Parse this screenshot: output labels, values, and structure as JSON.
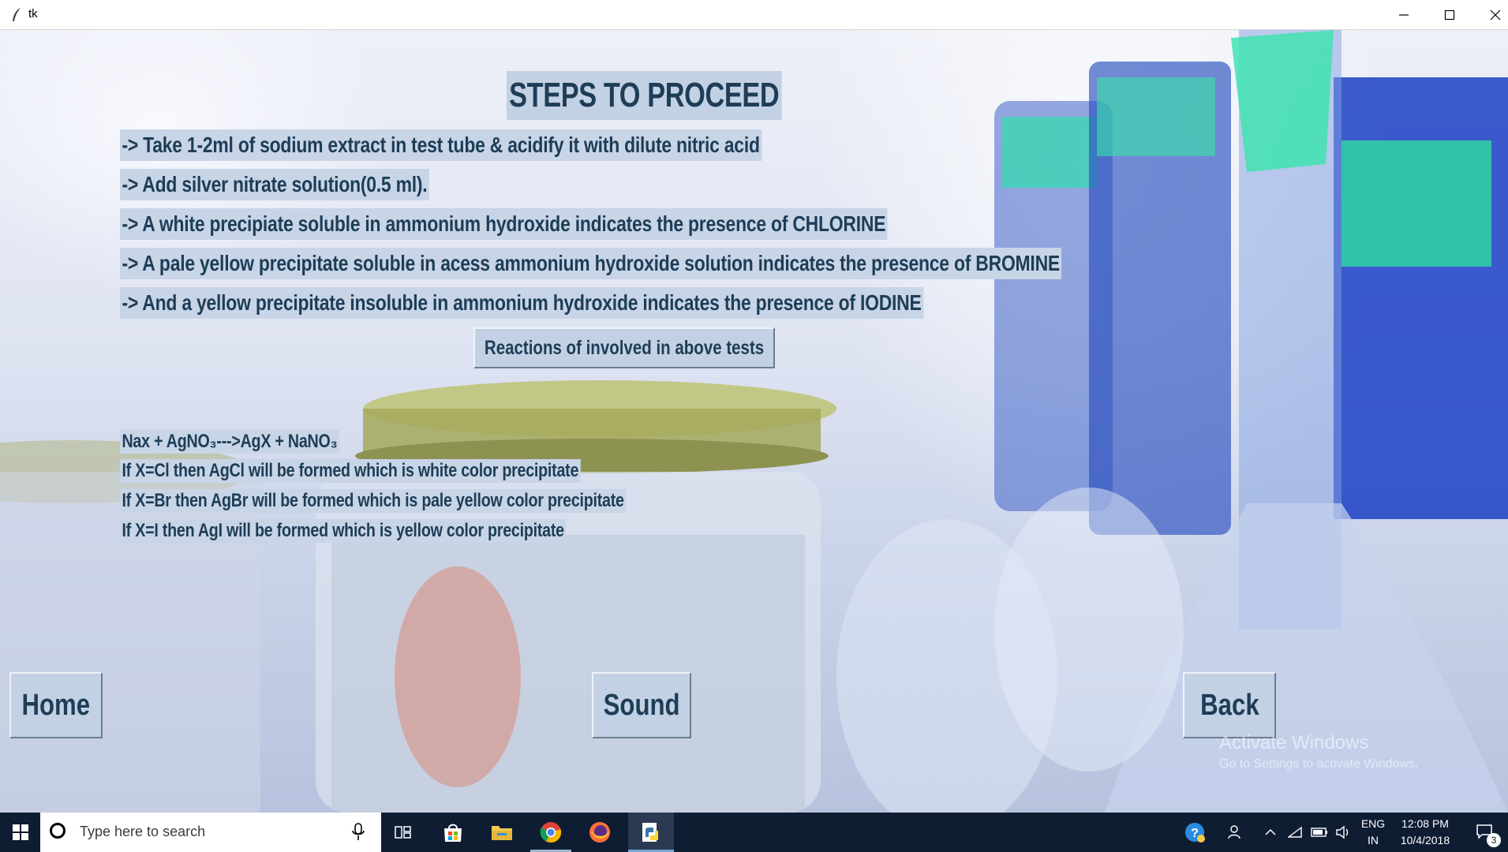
{
  "window": {
    "title": "tk"
  },
  "main": {
    "heading": "STEPS TO PROCEED",
    "steps": [
      "-> Take 1-2ml of sodium extract in test tube & acidify it with dilute nitric acid",
      "-> Add silver nitrate solution(0.5 ml).",
      "-> A white precipiate soluble in ammonium hydroxide indicates the presence of CHLORINE",
      "-> A pale yellow precipitate soluble in acess ammonium hydroxide solution indicates the presence of BROMINE",
      "-> And a yellow precipitate insoluble in ammonium hydroxide indicates the presence of IODINE"
    ],
    "reactions_button": "Reactions of involved in above tests",
    "reactions": [
      "Nax + AgNO₃--->AgX + NaNO₃",
      "If X=Cl then AgCl will be formed which is white color precipitate",
      "If X=Br then AgBr will be formed which is pale yellow color precipitate",
      "If X=I then AgI will be formed which is yellow color precipitate"
    ]
  },
  "buttons": {
    "home": "Home",
    "sound": "Sound",
    "back": "Back"
  },
  "watermark": {
    "line1": "Activate Windows",
    "line2": "Go to Settings to activate Windows."
  },
  "taskbar": {
    "search_placeholder": "Type here to search",
    "language": "ENG",
    "region": "IN",
    "time": "12:08 PM",
    "date": "10/4/2018",
    "notification_count": "3",
    "apps": [
      "start-icon",
      "task-view-icon",
      "store-icon",
      "file-explorer-icon",
      "chrome-icon",
      "firefox-icon",
      "python-icon"
    ]
  },
  "colors": {
    "label_bg": "#c8d5e6",
    "label_text": "#1e3d57",
    "taskbar_bg": "#0f1d33"
  }
}
